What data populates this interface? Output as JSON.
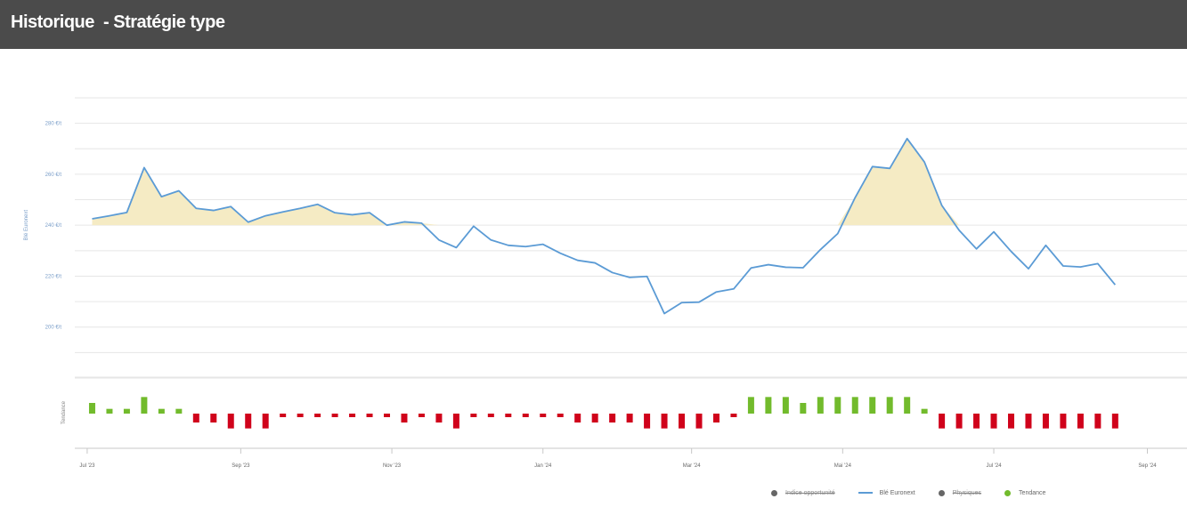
{
  "header": {
    "title": "Historique  - Stratégie type"
  },
  "colors": {
    "header_bg": "#4b4b4b",
    "price_line": "#5b9bd5",
    "area_fill": "#f5ebc4",
    "positive_bar": "#72bb2c",
    "negative_bar": "#d0021b",
    "hidden_series": "#666666"
  },
  "chart_data": {
    "type": "line",
    "ylabel": "Blé Euronext",
    "ylabel2": "Tendance",
    "y_ticks": [
      "200 €/t",
      "220 €/t",
      "240 €/t",
      "260 €/t",
      "280 €/t"
    ],
    "ylim": [
      180,
      290
    ],
    "baseline": 240,
    "x_ticks": [
      "Jul '23",
      "Sep '23",
      "Nov '23",
      "Jan '24",
      "Mar '24",
      "Mai '24",
      "Jul '24",
      "Sep '24"
    ],
    "xlim": [
      "2023-06-26",
      "2024-09-17"
    ],
    "legend_position": "bottom-right",
    "series": [
      {
        "name": "Blé Euronext",
        "color": "#5b9bd5",
        "points": [
          [
            "2023-07-03",
            242.5
          ],
          [
            "2023-07-10",
            243.7
          ],
          [
            "2023-07-17",
            245.0
          ],
          [
            "2023-07-24",
            262.6
          ],
          [
            "2023-07-31",
            251.2
          ],
          [
            "2023-08-07",
            253.5
          ],
          [
            "2023-08-14",
            246.6
          ],
          [
            "2023-08-21",
            245.8
          ],
          [
            "2023-08-28",
            247.3
          ],
          [
            "2023-09-04",
            241.2
          ],
          [
            "2023-09-11",
            243.7
          ],
          [
            "2023-09-18",
            245.2
          ],
          [
            "2023-09-25",
            246.6
          ],
          [
            "2023-10-02",
            248.2
          ],
          [
            "2023-10-09",
            244.9
          ],
          [
            "2023-10-16",
            244.1
          ],
          [
            "2023-10-23",
            244.9
          ],
          [
            "2023-10-30",
            240.0
          ],
          [
            "2023-11-06",
            241.3
          ],
          [
            "2023-11-13",
            240.8
          ],
          [
            "2023-11-20",
            234.2
          ],
          [
            "2023-11-27",
            231.2
          ],
          [
            "2023-12-04",
            239.6
          ],
          [
            "2023-12-11",
            234.2
          ],
          [
            "2023-12-18",
            232.1
          ],
          [
            "2023-12-25",
            231.6
          ],
          [
            "2024-01-01",
            232.5
          ],
          [
            "2024-01-08",
            229.0
          ],
          [
            "2024-01-15",
            226.2
          ],
          [
            "2024-01-22",
            225.2
          ],
          [
            "2024-01-29",
            221.4
          ],
          [
            "2024-02-05",
            219.5
          ],
          [
            "2024-02-12",
            219.9
          ],
          [
            "2024-02-19",
            205.3
          ],
          [
            "2024-02-26",
            209.6
          ],
          [
            "2024-03-04",
            209.8
          ],
          [
            "2024-03-11",
            213.8
          ],
          [
            "2024-03-18",
            215.0
          ],
          [
            "2024-03-25",
            223.2
          ],
          [
            "2024-04-01",
            224.5
          ],
          [
            "2024-04-08",
            223.5
          ],
          [
            "2024-04-15",
            223.3
          ],
          [
            "2024-04-22",
            230.4
          ],
          [
            "2024-04-29",
            236.7
          ],
          [
            "2024-05-06",
            250.8
          ],
          [
            "2024-05-13",
            263.0
          ],
          [
            "2024-05-20",
            262.3
          ],
          [
            "2024-05-27",
            274.0
          ],
          [
            "2024-06-03",
            264.8
          ],
          [
            "2024-06-10",
            247.8
          ],
          [
            "2024-06-17",
            238.0
          ],
          [
            "2024-06-24",
            230.7
          ],
          [
            "2024-07-01",
            237.4
          ],
          [
            "2024-07-08",
            229.7
          ],
          [
            "2024-07-15",
            222.9
          ],
          [
            "2024-07-22",
            232.1
          ],
          [
            "2024-07-29",
            224.0
          ],
          [
            "2024-08-05",
            223.6
          ],
          [
            "2024-08-12",
            224.9
          ],
          [
            "2024-08-19",
            216.6
          ]
        ]
      },
      {
        "name": "Tendance",
        "color_positive": "#72bb2c",
        "color_negative": "#d0021b",
        "range": [
          -3,
          3
        ],
        "points": [
          [
            "2023-07-03",
            1.8
          ],
          [
            "2023-07-10",
            0.8
          ],
          [
            "2023-07-17",
            0.8
          ],
          [
            "2023-07-24",
            2.8
          ],
          [
            "2023-07-31",
            0.8
          ],
          [
            "2023-08-07",
            0.8
          ],
          [
            "2023-08-14",
            -1.5
          ],
          [
            "2023-08-21",
            -1.5
          ],
          [
            "2023-08-28",
            -2.5
          ],
          [
            "2023-09-04",
            -2.5
          ],
          [
            "2023-09-11",
            -2.5
          ],
          [
            "2023-09-18",
            -0.6
          ],
          [
            "2023-09-25",
            -0.6
          ],
          [
            "2023-10-02",
            -0.6
          ],
          [
            "2023-10-09",
            -0.6
          ],
          [
            "2023-10-16",
            -0.6
          ],
          [
            "2023-10-23",
            -0.6
          ],
          [
            "2023-10-30",
            -0.6
          ],
          [
            "2023-11-06",
            -1.5
          ],
          [
            "2023-11-13",
            -0.6
          ],
          [
            "2023-11-20",
            -1.5
          ],
          [
            "2023-11-27",
            -2.5
          ],
          [
            "2023-12-04",
            -0.6
          ],
          [
            "2023-12-11",
            -0.6
          ],
          [
            "2023-12-18",
            -0.6
          ],
          [
            "2023-12-25",
            -0.6
          ],
          [
            "2024-01-01",
            -0.6
          ],
          [
            "2024-01-08",
            -0.6
          ],
          [
            "2024-01-15",
            -1.5
          ],
          [
            "2024-01-22",
            -1.5
          ],
          [
            "2024-01-29",
            -1.5
          ],
          [
            "2024-02-05",
            -1.5
          ],
          [
            "2024-02-12",
            -2.5
          ],
          [
            "2024-02-19",
            -2.5
          ],
          [
            "2024-02-26",
            -2.5
          ],
          [
            "2024-03-04",
            -2.5
          ],
          [
            "2024-03-11",
            -1.5
          ],
          [
            "2024-03-18",
            -0.6
          ],
          [
            "2024-03-25",
            2.8
          ],
          [
            "2024-04-01",
            2.8
          ],
          [
            "2024-04-08",
            2.8
          ],
          [
            "2024-04-15",
            1.8
          ],
          [
            "2024-04-22",
            2.8
          ],
          [
            "2024-04-29",
            2.8
          ],
          [
            "2024-05-06",
            2.8
          ],
          [
            "2024-05-13",
            2.8
          ],
          [
            "2024-05-20",
            2.8
          ],
          [
            "2024-05-27",
            2.8
          ],
          [
            "2024-06-03",
            0.8
          ],
          [
            "2024-06-10",
            -2.5
          ],
          [
            "2024-06-17",
            -2.5
          ],
          [
            "2024-06-24",
            -2.5
          ],
          [
            "2024-07-01",
            -2.5
          ],
          [
            "2024-07-08",
            -2.5
          ],
          [
            "2024-07-15",
            -2.5
          ],
          [
            "2024-07-22",
            -2.5
          ],
          [
            "2024-07-29",
            -2.5
          ],
          [
            "2024-08-05",
            -2.5
          ],
          [
            "2024-08-12",
            -2.5
          ],
          [
            "2024-08-19",
            -2.5
          ]
        ]
      }
    ],
    "legend": [
      {
        "label": "Indice opportunité",
        "symbol": "dot",
        "color": "#666666",
        "hidden": true
      },
      {
        "label": "Blé Euronext",
        "symbol": "line",
        "color": "#5b9bd5",
        "hidden": false
      },
      {
        "label": "Physiques",
        "symbol": "dot",
        "color": "#666666",
        "hidden": true
      },
      {
        "label": "Tendance",
        "symbol": "dot",
        "color": "#72bb2c",
        "hidden": false
      }
    ]
  }
}
